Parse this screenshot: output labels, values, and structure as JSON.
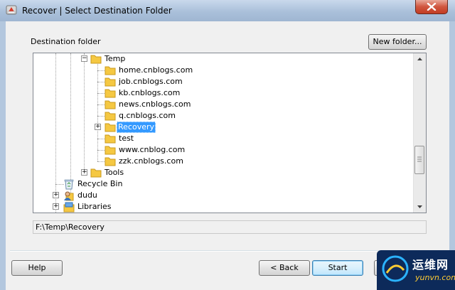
{
  "window": {
    "title": "Recover | Select Destination Folder"
  },
  "dialog": {
    "destination_label": "Destination folder",
    "new_folder_label": "New folder..."
  },
  "tree": {
    "items": [
      {
        "label": "Temp",
        "icon": "folder-icon",
        "expander": "minus"
      },
      {
        "label": "home.cnblogs.com",
        "icon": "folder-icon"
      },
      {
        "label": "job.cnblogs.com",
        "icon": "folder-icon"
      },
      {
        "label": "kb.cnblogs.com",
        "icon": "folder-icon"
      },
      {
        "label": "news.cnblogs.com",
        "icon": "folder-icon"
      },
      {
        "label": "q.cnblogs.com",
        "icon": "folder-icon"
      },
      {
        "label": "Recovery",
        "icon": "folder-icon",
        "expander": "plus",
        "selected": true
      },
      {
        "label": "test",
        "icon": "folder-icon"
      },
      {
        "label": "www.cnblog.com",
        "icon": "folder-icon"
      },
      {
        "label": "zzk.cnblogs.com",
        "icon": "folder-icon"
      },
      {
        "label": "Tools",
        "icon": "folder-icon",
        "expander": "plus"
      },
      {
        "label": "Recycle Bin",
        "icon": "recycle-bin-icon"
      },
      {
        "label": "dudu",
        "icon": "user-folder-icon",
        "expander": "plus"
      },
      {
        "label": "Libraries",
        "icon": "libraries-icon",
        "expander": "plus"
      }
    ]
  },
  "path": {
    "value": "F:\\Temp\\Recovery"
  },
  "buttons": {
    "help": "Help",
    "back": "< Back",
    "start": "Start",
    "cancel": ""
  },
  "watermark": {
    "cn": "运维网",
    "en": "yunvn.com"
  },
  "colors": {
    "selection": "#3399ff",
    "close_button": "#c8432a",
    "folder": "#f5c842"
  }
}
